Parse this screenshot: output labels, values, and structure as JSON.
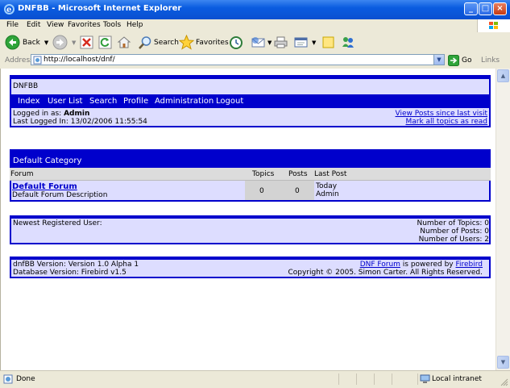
{
  "window": {
    "title": "DNFBB - Microsoft Internet Explorer"
  },
  "menu": {
    "items": [
      "File",
      "Edit",
      "View",
      "Favorites",
      "Tools",
      "Help"
    ]
  },
  "toolbar": {
    "back": "Back",
    "search": "Search",
    "favorites": "Favorites"
  },
  "address": {
    "label": "Address",
    "url": "http://localhost/dnf/",
    "go": "Go",
    "links": "Links"
  },
  "forum": {
    "site_title": "DNFBB",
    "nav": [
      "Index",
      "User List",
      "Search",
      "Profile",
      "Administration",
      "Logout"
    ],
    "login": {
      "logged_in_label": "Logged in as:",
      "user": "Admin",
      "last_logged": "Last Logged In: 13/02/2006 11:55:54"
    },
    "quick_links": {
      "view_posts": "View Posts since last visit",
      "mark_read": "Mark all topics as read"
    },
    "category": {
      "title": "Default Category",
      "columns": {
        "forum": "Forum",
        "topics": "Topics",
        "posts": "Posts",
        "last_post": "Last Post"
      },
      "rows": [
        {
          "name": "Default Forum",
          "description": "Default Forum Description",
          "topics": "0",
          "posts": "0",
          "last_post_when": "Today",
          "last_post_by": "Admin"
        }
      ]
    },
    "stats": {
      "newest_user_label": "Newest Registered User:",
      "topics": "Number of Topics: 0",
      "posts": "Number of Posts: 0",
      "users": "Number of Users: 2"
    },
    "footer": {
      "version": "dnfBB Version: Version 1.0 Alpha 1",
      "db_version": "Database Version: Firebird v1.5",
      "powered_link": "DNF Forum",
      "powered_text": " is powered by ",
      "firebird_link": "Firebird",
      "copyright": "Copyright © 2005. Simon Carter. All Rights Reserved."
    }
  },
  "status": {
    "text": "Done",
    "zone": "Local intranet"
  }
}
